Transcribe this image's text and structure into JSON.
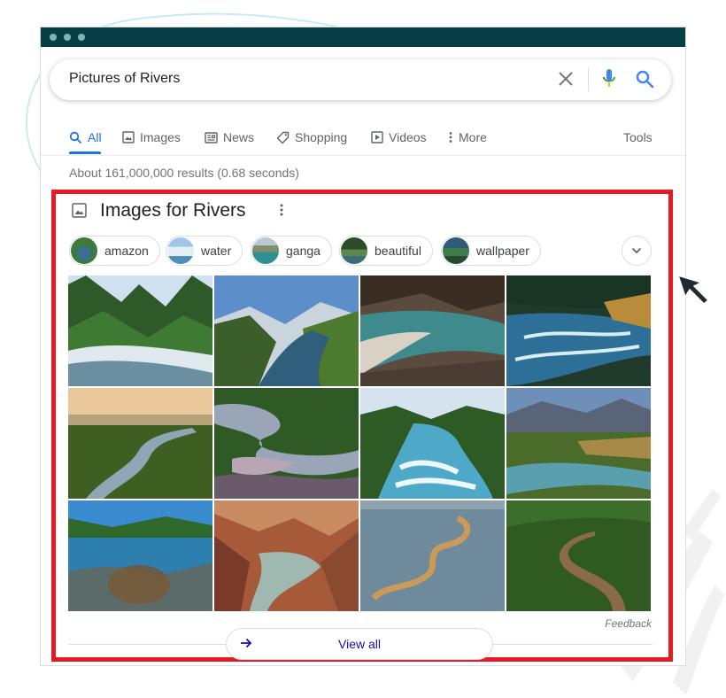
{
  "search": {
    "query": "Pictures of Rivers"
  },
  "tabs": [
    {
      "label": "All",
      "icon": "search-icon",
      "active": true
    },
    {
      "label": "Images",
      "icon": "image-icon"
    },
    {
      "label": "News",
      "icon": "news-icon"
    },
    {
      "label": "Shopping",
      "icon": "tag-icon"
    },
    {
      "label": "Videos",
      "icon": "play-icon"
    },
    {
      "label": "More",
      "icon": "more-vert-icon"
    }
  ],
  "tools_label": "Tools",
  "results_stats": "About 161,000,000 results (0.68 seconds)",
  "images_section": {
    "title": "Images for Rivers",
    "chips": [
      "amazon",
      "water",
      "ganga",
      "beautiful",
      "wallpaper"
    ],
    "feedback_label": "Feedback",
    "view_all_label": "View all"
  },
  "colors": {
    "titlebar": "#053f45",
    "highlight_border": "#e31b23",
    "accent": "#1a73e8",
    "link": "#1a0dab"
  }
}
